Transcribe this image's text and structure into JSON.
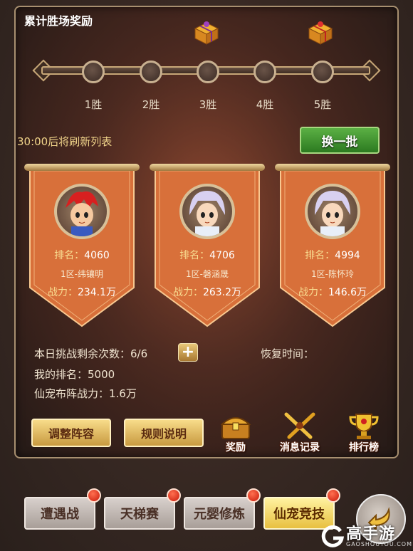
{
  "panel": {
    "title": "累计胜场奖励"
  },
  "progress": {
    "nodes": [
      "1胜",
      "2胜",
      "3胜",
      "4胜",
      "5胜"
    ],
    "reward_icons": [
      "gift-chest-icon",
      "gift-chest-icon"
    ]
  },
  "refresh": {
    "text": "30:00后将刷新列表",
    "button": "换一批"
  },
  "opponents": [
    {
      "rank_label": "排名：",
      "rank": "4060",
      "name": "1区-纬镶明",
      "power_label": "战力：",
      "power": "234.1万",
      "avatar": "red-hair-warrior"
    },
    {
      "rank_label": "排名：",
      "rank": "4706",
      "name": "1区-磐涵晟",
      "power_label": "战力：",
      "power": "263.2万",
      "avatar": "silver-hair-hero"
    },
    {
      "rank_label": "排名：",
      "rank": "4994",
      "name": "1区-陈怀玲",
      "power_label": "战力：",
      "power": "146.6万",
      "avatar": "silver-hair-hero"
    }
  ],
  "stats": {
    "challenges": "本日挑战剩余次数：6/6",
    "my_rank": "我的排名：5000",
    "pet_power": "仙宠布阵战力：1.6万",
    "recover": "恢复时间："
  },
  "actions": {
    "adjust": "调整阵容",
    "rules": "规则说明",
    "reward": "奖励",
    "messages": "消息记录",
    "leaderboard": "排行榜"
  },
  "tabs": [
    "遭遇战",
    "天梯赛",
    "元婴修炼",
    "仙宠竞技"
  ],
  "active_tab": "仙宠竞技",
  "watermark": {
    "main": "高手游",
    "sub": "GAOSHOUYOU.COM"
  },
  "colors": {
    "banner": "#d8703a",
    "accent_gold": "#f8dc90",
    "green_button": "#3a9030"
  }
}
